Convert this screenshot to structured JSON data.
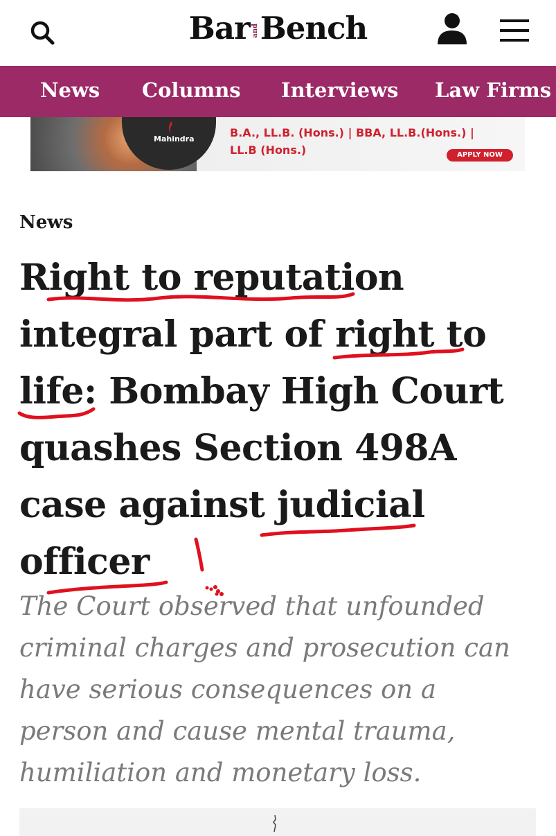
{
  "header": {
    "logo_left": "Bar",
    "logo_and": "and",
    "logo_right": "Bench",
    "icons": [
      "search-icon",
      "user-icon",
      "menu-icon"
    ]
  },
  "nav": {
    "items": [
      "News",
      "Columns",
      "Interviews",
      "Law Firms"
    ]
  },
  "ad": {
    "brand": "Mahindra",
    "line1": "B.A., LL.B. (Hons.) | BBA, LL.B.(Hons.) |",
    "line2": "LL.B (Hons.)",
    "cta": "APPLY NOW",
    "accent": "#d0202e"
  },
  "article": {
    "section": "News",
    "headline": "Right to reputation integral part of right to life: Bombay High Court quashes Section 498A case against judicial officer",
    "deck": "The Court observed that unfounded criminal charges and prosecution can have serious consequences on a person and cause mental trauma, humiliation and monetary loss."
  },
  "colors": {
    "brand": "#9c2a66",
    "annotation": "#e0101e",
    "deck_text": "#7a7a7a"
  }
}
